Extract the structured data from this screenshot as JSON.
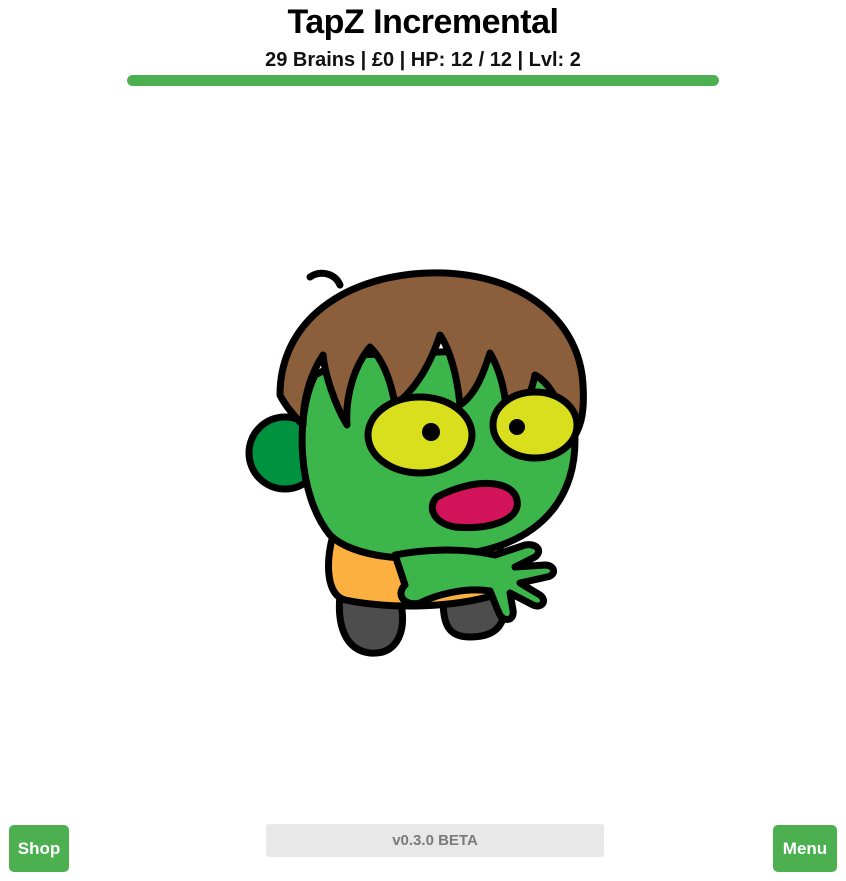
{
  "header": {
    "title": "TapZ Incremental",
    "stats": "29 Brains | £0 | HP: 12 / 12 | Lvl: 2"
  },
  "hp": {
    "current": 12,
    "max": 12,
    "fill_fraction": 1.0,
    "color": "#4caf50"
  },
  "zombie": {
    "icon": "zombie-character",
    "colors": {
      "skin": "#3cb54a",
      "hair": "#8b5e3c",
      "eyes": "#d9df1d",
      "mouth": "#d4145a",
      "shirt": "#fbb040",
      "pants": "#4d4d4d"
    }
  },
  "footer": {
    "shop_label": "Shop",
    "menu_label": "Menu",
    "version": "v0.3.0 BETA"
  },
  "colors": {
    "accent": "#4caf50",
    "version_bg": "#e8e8e8"
  }
}
